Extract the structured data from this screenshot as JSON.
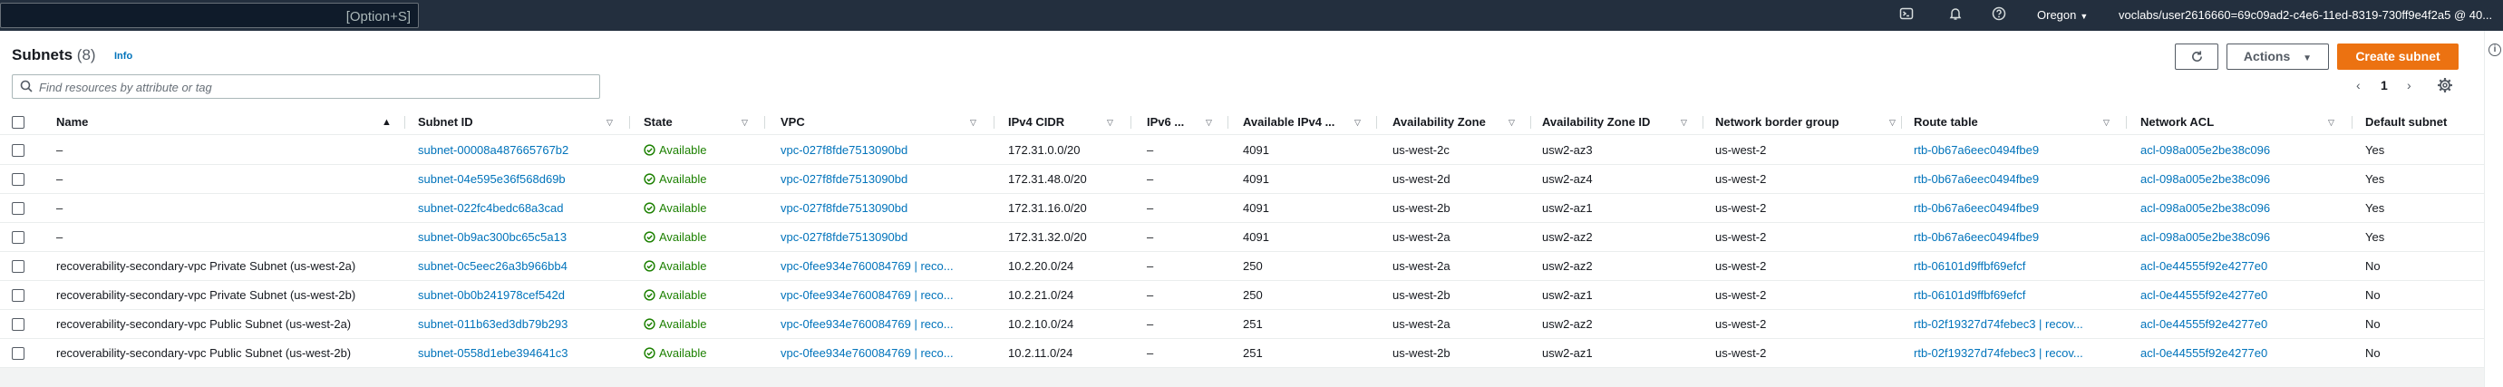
{
  "topbar": {
    "search_shortcut": "[Option+S]",
    "region": "Oregon",
    "user": "voclabs/user2616660=69c09ad2-c4e6-11ed-8319-730ff9e4f2a5 @ 40..."
  },
  "header": {
    "title": "Subnets",
    "count": "(8)",
    "info": "Info",
    "search_placeholder": "Find resources by attribute or tag"
  },
  "toolbar": {
    "actions_label": "Actions",
    "create_label": "Create subnet",
    "page_number": "1",
    "prev": "‹",
    "next": "›"
  },
  "icons": [
    "terminal-icon",
    "bell-icon",
    "help-icon",
    "refresh-icon",
    "caret-down-icon",
    "gear-icon",
    "search-icon",
    "info-icon"
  ],
  "colors": {
    "topbar": "#232f3e",
    "link": "#0073bb",
    "primary": "#ec7211",
    "success": "#1d8102"
  },
  "table": {
    "columns": [
      "Name",
      "Subnet ID",
      "State",
      "VPC",
      "IPv4 CIDR",
      "IPv6 ...",
      "Available IPv4 ...",
      "Availability Zone",
      "Availability Zone ID",
      "Network border group",
      "Route table",
      "Network ACL",
      "Default subnet"
    ],
    "rows": [
      [
        "–",
        "subnet-00008a487665767b2",
        "Available",
        "vpc-027f8fde7513090bd",
        "172.31.0.0/20",
        "–",
        "4091",
        "us-west-2c",
        "usw2-az3",
        "us-west-2",
        "rtb-0b67a6eec0494fbe9",
        "acl-098a005e2be38c096",
        "Yes"
      ],
      [
        "–",
        "subnet-04e595e36f568d69b",
        "Available",
        "vpc-027f8fde7513090bd",
        "172.31.48.0/20",
        "–",
        "4091",
        "us-west-2d",
        "usw2-az4",
        "us-west-2",
        "rtb-0b67a6eec0494fbe9",
        "acl-098a005e2be38c096",
        "Yes"
      ],
      [
        "–",
        "subnet-022fc4bedc68a3cad",
        "Available",
        "vpc-027f8fde7513090bd",
        "172.31.16.0/20",
        "–",
        "4091",
        "us-west-2b",
        "usw2-az1",
        "us-west-2",
        "rtb-0b67a6eec0494fbe9",
        "acl-098a005e2be38c096",
        "Yes"
      ],
      [
        "–",
        "subnet-0b9ac300bc65c5a13",
        "Available",
        "vpc-027f8fde7513090bd",
        "172.31.32.0/20",
        "–",
        "4091",
        "us-west-2a",
        "usw2-az2",
        "us-west-2",
        "rtb-0b67a6eec0494fbe9",
        "acl-098a005e2be38c096",
        "Yes"
      ],
      [
        "recoverability-secondary-vpc Private Subnet (us-west-2a)",
        "subnet-0c5eec26a3b966bb4",
        "Available",
        "vpc-0fee934e760084769 | reco...",
        "10.2.20.0/24",
        "–",
        "250",
        "us-west-2a",
        "usw2-az2",
        "us-west-2",
        "rtb-06101d9ffbf69efcf",
        "acl-0e44555f92e4277e0",
        "No"
      ],
      [
        "recoverability-secondary-vpc Private Subnet (us-west-2b)",
        "subnet-0b0b241978cef542d",
        "Available",
        "vpc-0fee934e760084769 | reco...",
        "10.2.21.0/24",
        "–",
        "250",
        "us-west-2b",
        "usw2-az1",
        "us-west-2",
        "rtb-06101d9ffbf69efcf",
        "acl-0e44555f92e4277e0",
        "No"
      ],
      [
        "recoverability-secondary-vpc Public Subnet (us-west-2a)",
        "subnet-011b63ed3db79b293",
        "Available",
        "vpc-0fee934e760084769 | reco...",
        "10.2.10.0/24",
        "–",
        "251",
        "us-west-2a",
        "usw2-az2",
        "us-west-2",
        "rtb-02f19327d74febec3 | recov...",
        "acl-0e44555f92e4277e0",
        "No"
      ],
      [
        "recoverability-secondary-vpc Public Subnet (us-west-2b)",
        "subnet-0558d1ebe394641c3",
        "Available",
        "vpc-0fee934e760084769 | reco...",
        "10.2.11.0/24",
        "–",
        "251",
        "us-west-2b",
        "usw2-az1",
        "us-west-2",
        "rtb-02f19327d74febec3 | recov...",
        "acl-0e44555f92e4277e0",
        "No"
      ]
    ]
  }
}
